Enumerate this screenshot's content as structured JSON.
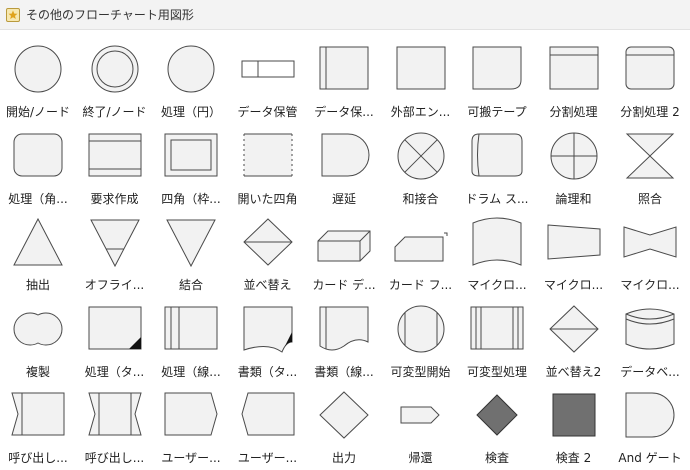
{
  "window": {
    "title": "その他のフローチャート用図形",
    "icon": "library-icon"
  },
  "colors": {
    "shape_fill": "#f2f2f2",
    "shape_stroke": "#4a4a4a",
    "dark_fill": "#707070"
  },
  "shapes": [
    {
      "label": "開始/ノード",
      "icon": "circle"
    },
    {
      "label": "終了/ノード",
      "icon": "double-circle"
    },
    {
      "label": "処理（円）",
      "icon": "circle"
    },
    {
      "label": "データ保管",
      "icon": "stored-data-line"
    },
    {
      "label": "データ保...",
      "icon": "rect-left-line"
    },
    {
      "label": "外部エン...",
      "icon": "rect"
    },
    {
      "label": "可搬テープ",
      "icon": "tape"
    },
    {
      "label": "分割処理",
      "icon": "rect-top-line"
    },
    {
      "label": "分割処理 2",
      "icon": "rounded-rect-top-line"
    },
    {
      "label": "処理（角...",
      "icon": "rounded-rect"
    },
    {
      "label": "要求作成",
      "icon": "rect-top-bottom-lines"
    },
    {
      "label": "四角（枠...",
      "icon": "double-rect"
    },
    {
      "label": "開いた四角",
      "icon": "open-rect"
    },
    {
      "label": "遅延",
      "icon": "delay"
    },
    {
      "label": "和接合",
      "icon": "circle-x"
    },
    {
      "label": "ドラム ス...",
      "icon": "drum"
    },
    {
      "label": "論理和",
      "icon": "circle-plus"
    },
    {
      "label": "照合",
      "icon": "hourglass"
    },
    {
      "label": "抽出",
      "icon": "triangle-up"
    },
    {
      "label": "オフライ...",
      "icon": "triangle-down-line"
    },
    {
      "label": "結合",
      "icon": "triangle-down"
    },
    {
      "label": "並べ替え",
      "icon": "diamond-line"
    },
    {
      "label": "カード デ...",
      "icon": "card-3d"
    },
    {
      "label": "カード フ...",
      "icon": "card-flat"
    },
    {
      "label": "マイクロ...",
      "icon": "microfilm"
    },
    {
      "label": "マイクロ...",
      "icon": "funnel-right"
    },
    {
      "label": "マイクロ...",
      "icon": "bowtie"
    },
    {
      "label": "複製",
      "icon": "twin-circle"
    },
    {
      "label": "処理（タ...",
      "icon": "rect-dark-corner"
    },
    {
      "label": "処理（線...",
      "icon": "rect-two-lines"
    },
    {
      "label": "書類（タ...",
      "icon": "document-dark-corner"
    },
    {
      "label": "書類（線...",
      "icon": "document-line"
    },
    {
      "label": "可変型開始",
      "icon": "circle-two-lines"
    },
    {
      "label": "可変型処理",
      "icon": "rect-four-lines"
    },
    {
      "label": "並べ替え2",
      "icon": "diamond-line"
    },
    {
      "label": "データベ...",
      "icon": "database"
    },
    {
      "label": "呼び出し...",
      "icon": "call-left"
    },
    {
      "label": "呼び出し...",
      "icon": "call-both"
    },
    {
      "label": "ユーザー...",
      "icon": "user-right"
    },
    {
      "label": "ユーザー...",
      "icon": "user-left"
    },
    {
      "label": "出力",
      "icon": "diamond"
    },
    {
      "label": "帰還",
      "icon": "pentagon-arrow"
    },
    {
      "label": "検査",
      "icon": "diamond-dark"
    },
    {
      "label": "検査 2",
      "icon": "square-dark"
    },
    {
      "label": "And ゲート",
      "icon": "and-gate"
    }
  ]
}
